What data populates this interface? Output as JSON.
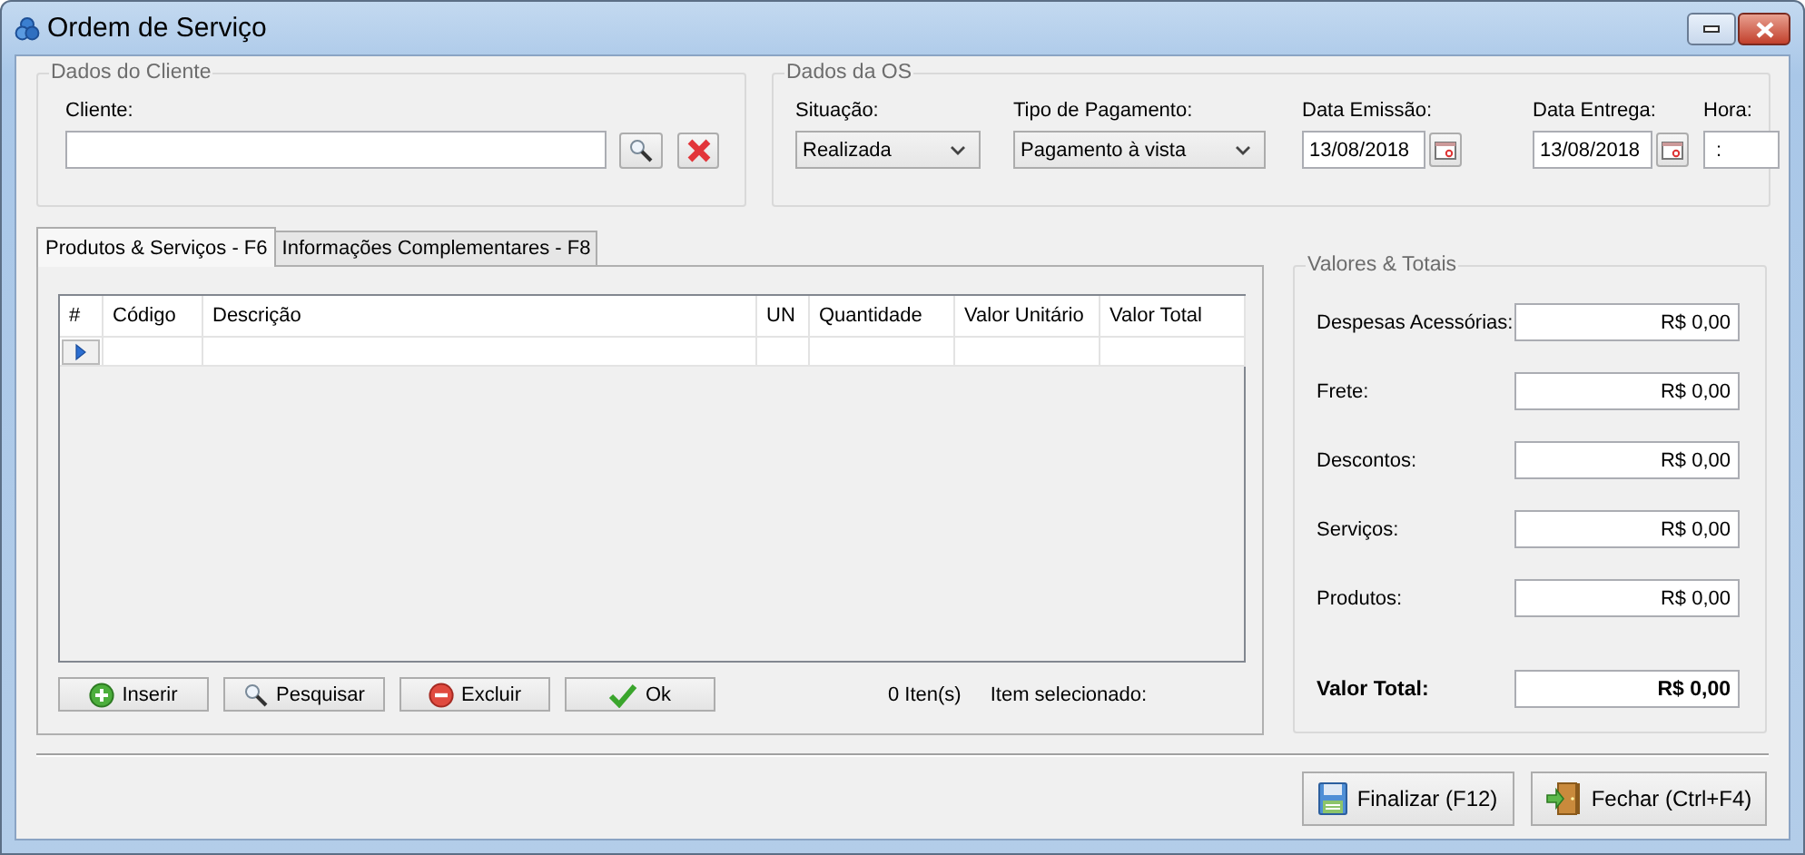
{
  "window": {
    "title": "Ordem de Serviço"
  },
  "client_group": {
    "title": "Dados do Cliente",
    "label": "Cliente:"
  },
  "os_group": {
    "title": "Dados da OS",
    "fields": [
      {
        "kind": "select",
        "label": "Situação:",
        "value": "Realizada"
      },
      {
        "kind": "select",
        "label": "Tipo de Pagamento:",
        "value": "Pagamento à vista"
      },
      {
        "kind": "date",
        "label": "Data Emissão:",
        "value": "13/08/2018"
      },
      {
        "kind": "date",
        "label": "Data Entrega:",
        "value": "13/08/2018"
      },
      {
        "kind": "time",
        "label": "Hora:",
        "value": ":"
      }
    ]
  },
  "tabs": [
    {
      "label": "Produtos & Serviços - F6",
      "selected": true
    },
    {
      "label": "Informações Complementares - F8",
      "selected": false
    }
  ],
  "table": {
    "columns": [
      "#",
      "Código",
      "Descrição",
      "UN",
      "Quantidade",
      "Valor Unitário",
      "Valor Total"
    ],
    "rows": [
      {
        "current": true
      }
    ]
  },
  "grid_buttons": [
    {
      "kind": "add",
      "label": "Inserir"
    },
    {
      "kind": "search",
      "label": "Pesquisar"
    },
    {
      "kind": "delete",
      "label": "Excluir"
    },
    {
      "kind": "ok",
      "label": "Ok"
    }
  ],
  "item_count": "0 Iten(s)",
  "selected_item_label": "Item selecionado:",
  "totals": {
    "title": "Valores & Totais",
    "rows": [
      {
        "kind": "line",
        "label": "Despesas Acessórias:",
        "value": "R$ 0,00"
      },
      {
        "kind": "line",
        "label": "Frete:",
        "value": "R$ 0,00"
      },
      {
        "kind": "line",
        "label": "Descontos:",
        "value": "R$ 0,00"
      },
      {
        "kind": "line",
        "label": "Serviços:",
        "value": "R$ 0,00"
      },
      {
        "kind": "line",
        "label": "Produtos:",
        "value": "R$ 0,00"
      },
      {
        "kind": "total",
        "label": "Valor Total:",
        "value": "R$ 0,00"
      }
    ]
  },
  "footer_buttons": [
    {
      "kind": "save",
      "label": "Finalizar (F12)"
    },
    {
      "kind": "exit",
      "label": "Fechar (Ctrl+F4)"
    }
  ]
}
